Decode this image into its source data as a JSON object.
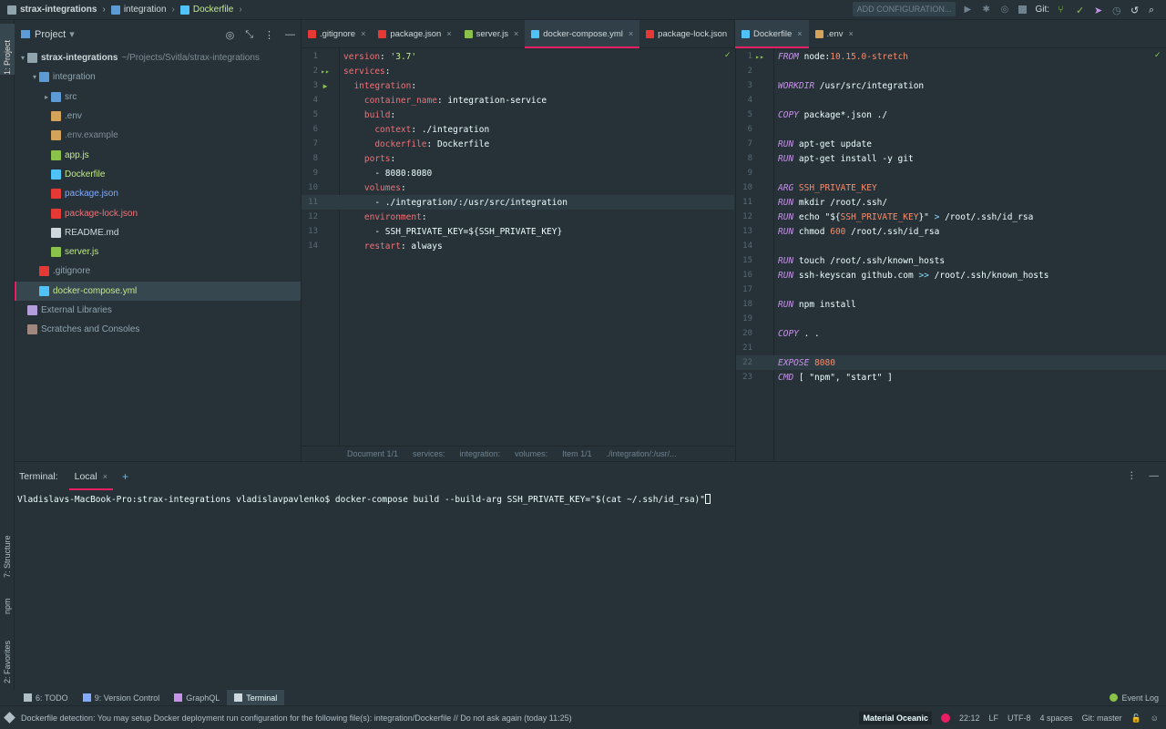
{
  "navbar": {
    "crumbs": [
      "strax-integrations",
      "integration",
      "Dockerfile"
    ],
    "add_config": "ADD CONFIGURATION...",
    "git_label": "Git:"
  },
  "leftstrip": {
    "project_tab": "1: Project",
    "structure_tab": "7: Structure",
    "npm_tab": "npm",
    "favorites_tab": "2: Favorites"
  },
  "project": {
    "title": "Project",
    "tree": [
      {
        "label": "strax-integrations",
        "hint": "~/Projects/Svitla/strax-integrations",
        "depth": 0,
        "arrow": "▾",
        "icon": "folder",
        "color": "#cfd8dc"
      },
      {
        "label": "integration",
        "depth": 1,
        "arrow": "▾",
        "icon": "folder-module",
        "color": "#90a4ae"
      },
      {
        "label": "src",
        "depth": 2,
        "arrow": "▸",
        "icon": "folder-src",
        "color": "#90a4ae"
      },
      {
        "label": ".env",
        "depth": 2,
        "arrow": "",
        "icon": "env",
        "color": "#90a4ae"
      },
      {
        "label": ".env.example",
        "depth": 2,
        "arrow": "",
        "icon": "env",
        "color": "#7f8c94"
      },
      {
        "label": "app.js",
        "depth": 2,
        "arrow": "",
        "icon": "nodejs",
        "color": "#c3e88d"
      },
      {
        "label": "Dockerfile",
        "depth": 2,
        "arrow": "",
        "icon": "docker",
        "color": "#c3e88d"
      },
      {
        "label": "package.json",
        "depth": 2,
        "arrow": "",
        "icon": "npm",
        "color": "#82aaff"
      },
      {
        "label": "package-lock.json",
        "depth": 2,
        "arrow": "",
        "icon": "lock",
        "color": "#f07178"
      },
      {
        "label": "README.md",
        "depth": 2,
        "arrow": "",
        "icon": "markdown",
        "color": "#cfd8dc"
      },
      {
        "label": "server.js",
        "depth": 2,
        "arrow": "",
        "icon": "nodejs",
        "color": "#c3e88d"
      },
      {
        "label": ".gitignore",
        "depth": 1,
        "arrow": "",
        "icon": "git",
        "color": "#90a4ae"
      },
      {
        "label": "docker-compose.yml",
        "depth": 1,
        "arrow": "",
        "icon": "docker",
        "color": "#c3e88d",
        "selected": true
      },
      {
        "label": "External Libraries",
        "depth": 0,
        "arrow": "",
        "icon": "library",
        "color": "#90a4ae"
      },
      {
        "label": "Scratches and Consoles",
        "depth": 0,
        "arrow": "",
        "icon": "scratch",
        "color": "#90a4ae"
      }
    ]
  },
  "tabs_left": [
    {
      "label": ".gitignore",
      "icon": "git",
      "active": false
    },
    {
      "label": "package.json",
      "icon": "npm",
      "active": false
    },
    {
      "label": "server.js",
      "icon": "nodejs",
      "active": false
    },
    {
      "label": "docker-compose.yml",
      "icon": "docker",
      "active": true
    },
    {
      "label": "package-lock.json",
      "icon": "lock",
      "active": false
    }
  ],
  "tabs_left_overflow": "2",
  "tabs_right": [
    {
      "label": "Dockerfile",
      "icon": "docker",
      "active": true
    },
    {
      "label": ".env",
      "icon": "env",
      "active": false
    }
  ],
  "editor_left": {
    "highlight_line": 11,
    "lines": [
      [
        [
          "k-key",
          "version"
        ],
        [
          "k-plain",
          ": "
        ],
        [
          "k-str",
          "'3.7'"
        ]
      ],
      [
        [
          "k-key",
          "services"
        ],
        [
          "k-plain",
          ":"
        ]
      ],
      [
        [
          "k-plain",
          "  "
        ],
        [
          "k-key",
          "integration"
        ],
        [
          "k-plain",
          ":"
        ]
      ],
      [
        [
          "k-plain",
          "    "
        ],
        [
          "k-key",
          "container_name"
        ],
        [
          "k-plain",
          ": integration-service"
        ]
      ],
      [
        [
          "k-plain",
          "    "
        ],
        [
          "k-key",
          "build"
        ],
        [
          "k-plain",
          ":"
        ]
      ],
      [
        [
          "k-plain",
          "      "
        ],
        [
          "k-key",
          "context"
        ],
        [
          "k-plain",
          ": ./integration"
        ]
      ],
      [
        [
          "k-plain",
          "      "
        ],
        [
          "k-key",
          "dockerfile"
        ],
        [
          "k-plain",
          ": Dockerfile"
        ]
      ],
      [
        [
          "k-plain",
          "    "
        ],
        [
          "k-key",
          "ports"
        ],
        [
          "k-plain",
          ":"
        ]
      ],
      [
        [
          "k-plain",
          "      - 8080:8080"
        ]
      ],
      [
        [
          "k-plain",
          "    "
        ],
        [
          "k-key",
          "volumes"
        ],
        [
          "k-plain",
          ":"
        ]
      ],
      [
        [
          "k-plain",
          "      - ./integration/:/usr/src/integration"
        ]
      ],
      [
        [
          "k-plain",
          "    "
        ],
        [
          "k-key",
          "environment"
        ],
        [
          "k-plain",
          ":"
        ]
      ],
      [
        [
          "k-plain",
          "      - SSH_PRIVATE_KEY=${SSH_PRIVATE_KEY}"
        ]
      ],
      [
        [
          "k-plain",
          "    "
        ],
        [
          "k-key",
          "restart"
        ],
        [
          "k-plain",
          ": always"
        ]
      ]
    ],
    "markers": {
      "2": "▸▸",
      "3": "▶"
    }
  },
  "editor_left_crumbs": [
    "Document 1/1",
    "services:",
    "integration:",
    "volumes:",
    "Item 1/1",
    "./integration/:/usr/..."
  ],
  "editor_right": {
    "highlight_line": 22,
    "lines": [
      [
        [
          "k-ins",
          "FROM"
        ],
        [
          "k-plain",
          " node:"
        ],
        [
          "k-num",
          "10.15.0-stretch"
        ]
      ],
      [],
      [
        [
          "k-ins",
          "WORKDIR"
        ],
        [
          "k-plain",
          " /usr/src/integration"
        ]
      ],
      [],
      [
        [
          "k-ins",
          "COPY"
        ],
        [
          "k-plain",
          " package*.json ./"
        ]
      ],
      [],
      [
        [
          "k-ins",
          "RUN"
        ],
        [
          "k-plain",
          " apt-get update"
        ]
      ],
      [
        [
          "k-ins",
          "RUN"
        ],
        [
          "k-plain",
          " apt-get install -y git"
        ]
      ],
      [],
      [
        [
          "k-ins",
          "ARG"
        ],
        [
          "k-plain",
          " "
        ],
        [
          "k-num",
          "SSH_PRIVATE_KEY"
        ]
      ],
      [
        [
          "k-ins",
          "RUN"
        ],
        [
          "k-plain",
          " mkdir /root/.ssh/"
        ]
      ],
      [
        [
          "k-ins",
          "RUN"
        ],
        [
          "k-plain",
          " echo \"${"
        ],
        [
          "k-num",
          "SSH_PRIVATE_KEY"
        ],
        [
          "k-plain",
          "}\" "
        ],
        [
          "k-op",
          ">"
        ],
        [
          "k-plain",
          " /root/.ssh/id_rsa"
        ]
      ],
      [
        [
          "k-ins",
          "RUN"
        ],
        [
          "k-plain",
          " chmod "
        ],
        [
          "k-num",
          "600"
        ],
        [
          "k-plain",
          " /root/.ssh/id_rsa"
        ]
      ],
      [],
      [
        [
          "k-ins",
          "RUN"
        ],
        [
          "k-plain",
          " touch /root/.ssh/known_hosts"
        ]
      ],
      [
        [
          "k-ins",
          "RUN"
        ],
        [
          "k-plain",
          " ssh-keyscan github.com "
        ],
        [
          "k-op",
          ">>"
        ],
        [
          "k-plain",
          " /root/.ssh/known_hosts"
        ]
      ],
      [],
      [
        [
          "k-ins",
          "RUN"
        ],
        [
          "k-plain",
          " npm install"
        ]
      ],
      [],
      [
        [
          "k-ins",
          "COPY"
        ],
        [
          "k-plain",
          " . ."
        ]
      ],
      [],
      [
        [
          "k-ins",
          "EXPOSE"
        ],
        [
          "k-plain",
          " "
        ],
        [
          "k-num",
          "8080"
        ]
      ],
      [
        [
          "k-ins",
          "CMD"
        ],
        [
          "k-plain",
          " [ \"npm\", \"start\" ]"
        ]
      ]
    ],
    "markers": {
      "1": "▸▸"
    }
  },
  "terminal": {
    "title": "Terminal:",
    "tab": "Local",
    "prompt": "Vladislavs-MacBook-Pro:strax-integrations vladislavpavlenko$ docker-compose build --build-arg SSH_PRIVATE_KEY=\"$(cat ~/.ssh/id_rsa)\""
  },
  "toolwindows": [
    {
      "label": "6: TODO",
      "active": false
    },
    {
      "label": "9: Version Control",
      "active": false
    },
    {
      "label": "GraphQL",
      "active": false
    },
    {
      "label": "Terminal",
      "active": true
    }
  ],
  "event_log": "Event Log",
  "status": {
    "message": "Dockerfile detection: You may setup Docker deployment run configuration for the following file(s): integration/Dockerfile // Do not ask again (today 11:25)",
    "theme": "Material Oceanic",
    "position": "22:12",
    "line_sep": "LF",
    "encoding": "UTF-8",
    "indent": "4 spaces",
    "branch": "Git: master"
  },
  "colors": {
    "accent": "#e91e63",
    "background": "#263238",
    "selection": "#37474f"
  }
}
